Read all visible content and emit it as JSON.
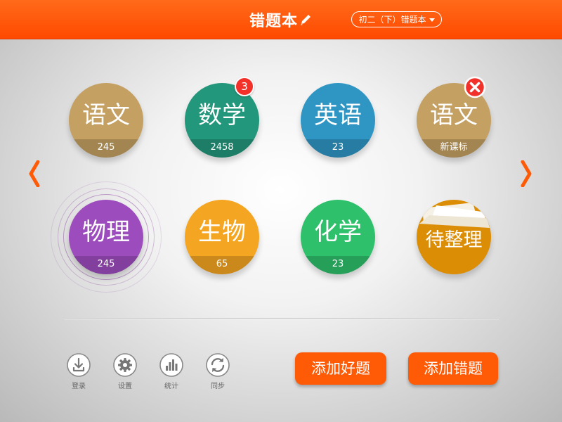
{
  "header": {
    "title": "错题本",
    "book_select": "初二（下）错题本"
  },
  "subjects": [
    {
      "name": "语文",
      "count": "245",
      "color": "#c4a063"
    },
    {
      "name": "数学",
      "count": "2458",
      "color": "#23977b",
      "badge": "3"
    },
    {
      "name": "英语",
      "count": "23",
      "color": "#2f96c4"
    },
    {
      "name": "语文",
      "count": "新课标",
      "color": "#c4a063"
    },
    {
      "name": "物理",
      "count": "245",
      "color": "#9d4cbd"
    },
    {
      "name": "生物",
      "count": "65",
      "color": "#f4a521"
    },
    {
      "name": "化学",
      "count": "23",
      "color": "#2ec06b"
    },
    {
      "name": "待整理",
      "color": "#dc8d06"
    }
  ],
  "toolbar": {
    "login": "登录",
    "settings": "设置",
    "stats": "统计",
    "sync": "同步"
  },
  "actions": {
    "add_good": "添加好题",
    "add_wrong": "添加错题"
  },
  "colors": {
    "accent": "#ff5a06",
    "header": "#ff4a00"
  },
  "icons": [
    "pencil-icon",
    "chevron-down-icon",
    "chevron-left-icon",
    "chevron-right-icon",
    "delete-icon",
    "download-icon",
    "gear-icon",
    "bar-chart-icon",
    "sync-icon"
  ]
}
